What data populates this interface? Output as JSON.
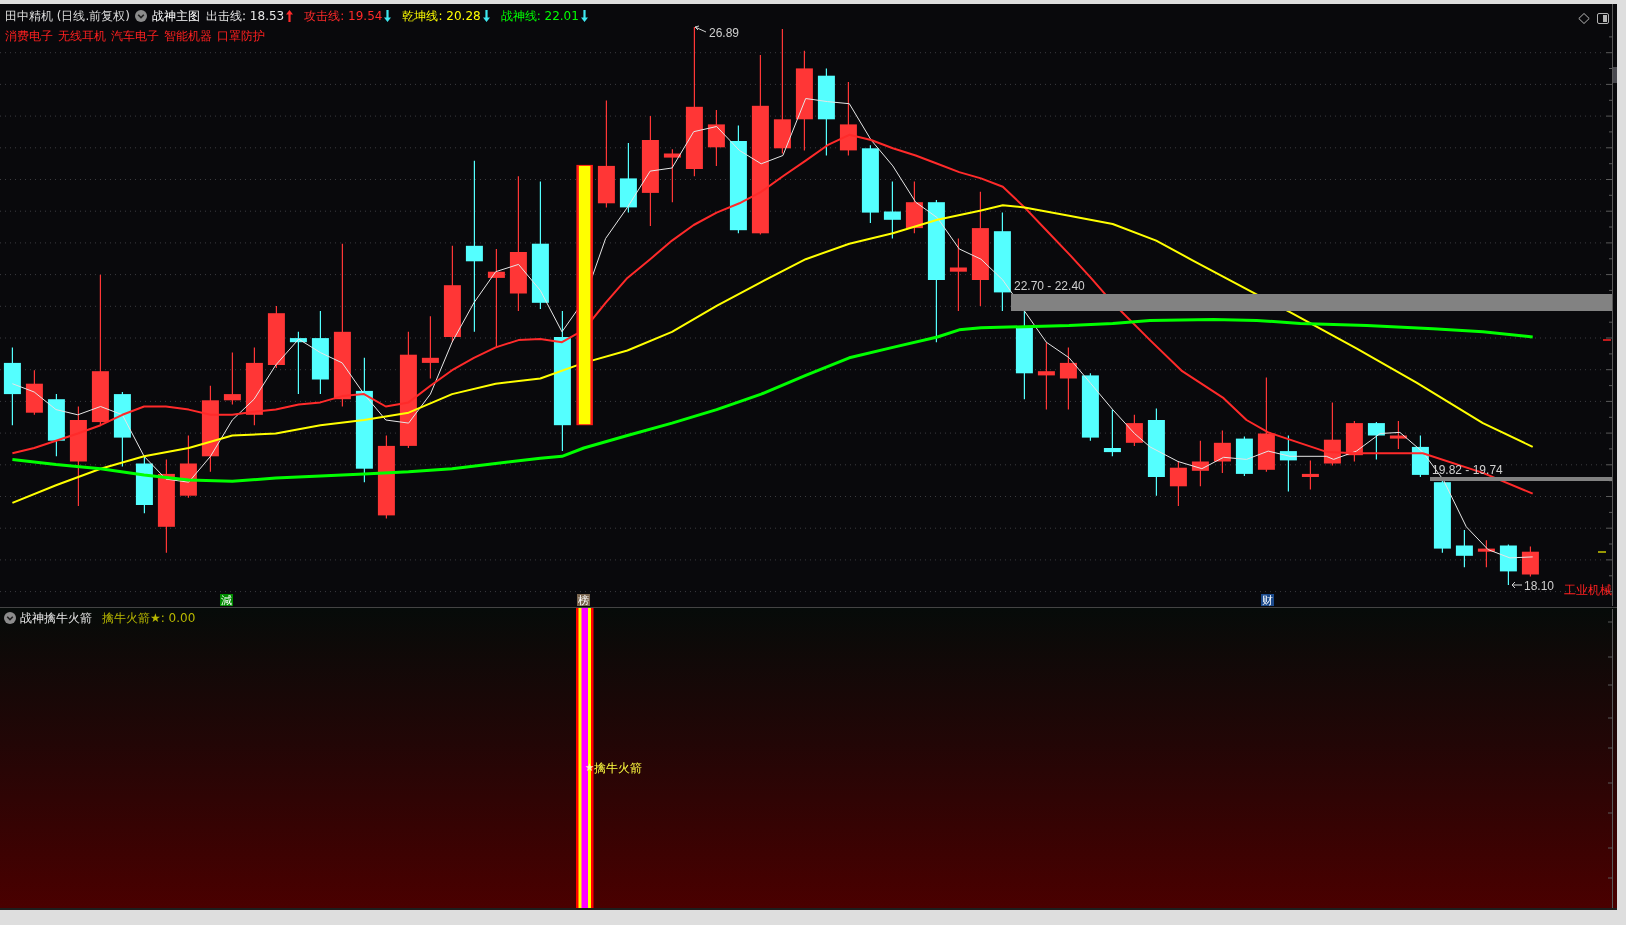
{
  "header": {
    "title": "田中精机 (日线.前复权)",
    "indicator": "战神主图",
    "lines": [
      {
        "text": "出击线: 18.53",
        "color": "#e6e6e6",
        "rising": true
      },
      {
        "text": "攻击线: 19.54",
        "color": "#ff2a2a",
        "rising": false
      },
      {
        "text": "乾坤线: 20.28",
        "color": "#ffff00",
        "rising": false
      },
      {
        "text": "战神线: 22.01",
        "color": "#00ff00",
        "rising": false
      }
    ],
    "concepts": [
      "消费电子",
      "无线耳机",
      "汽车电子",
      "智能机器",
      "口罩防护"
    ]
  },
  "chart": {
    "high_label": "26.89",
    "low_label": "18.10",
    "zones": [
      {
        "text": "22.70 - 22.40"
      },
      {
        "text": "19.82 - 19.74"
      }
    ],
    "sector_label": "工业机械",
    "event_tags": [
      {
        "text": "減",
        "color": "#008c00"
      },
      {
        "text": "榜",
        "color": "#7a6650"
      },
      {
        "text": "财",
        "color": "#1b4a8c"
      }
    ]
  },
  "sub_panel": {
    "title": "战神擒牛火箭",
    "reading": "擒牛火箭★: 0.00",
    "signal_label": "擒牛火箭"
  }
}
